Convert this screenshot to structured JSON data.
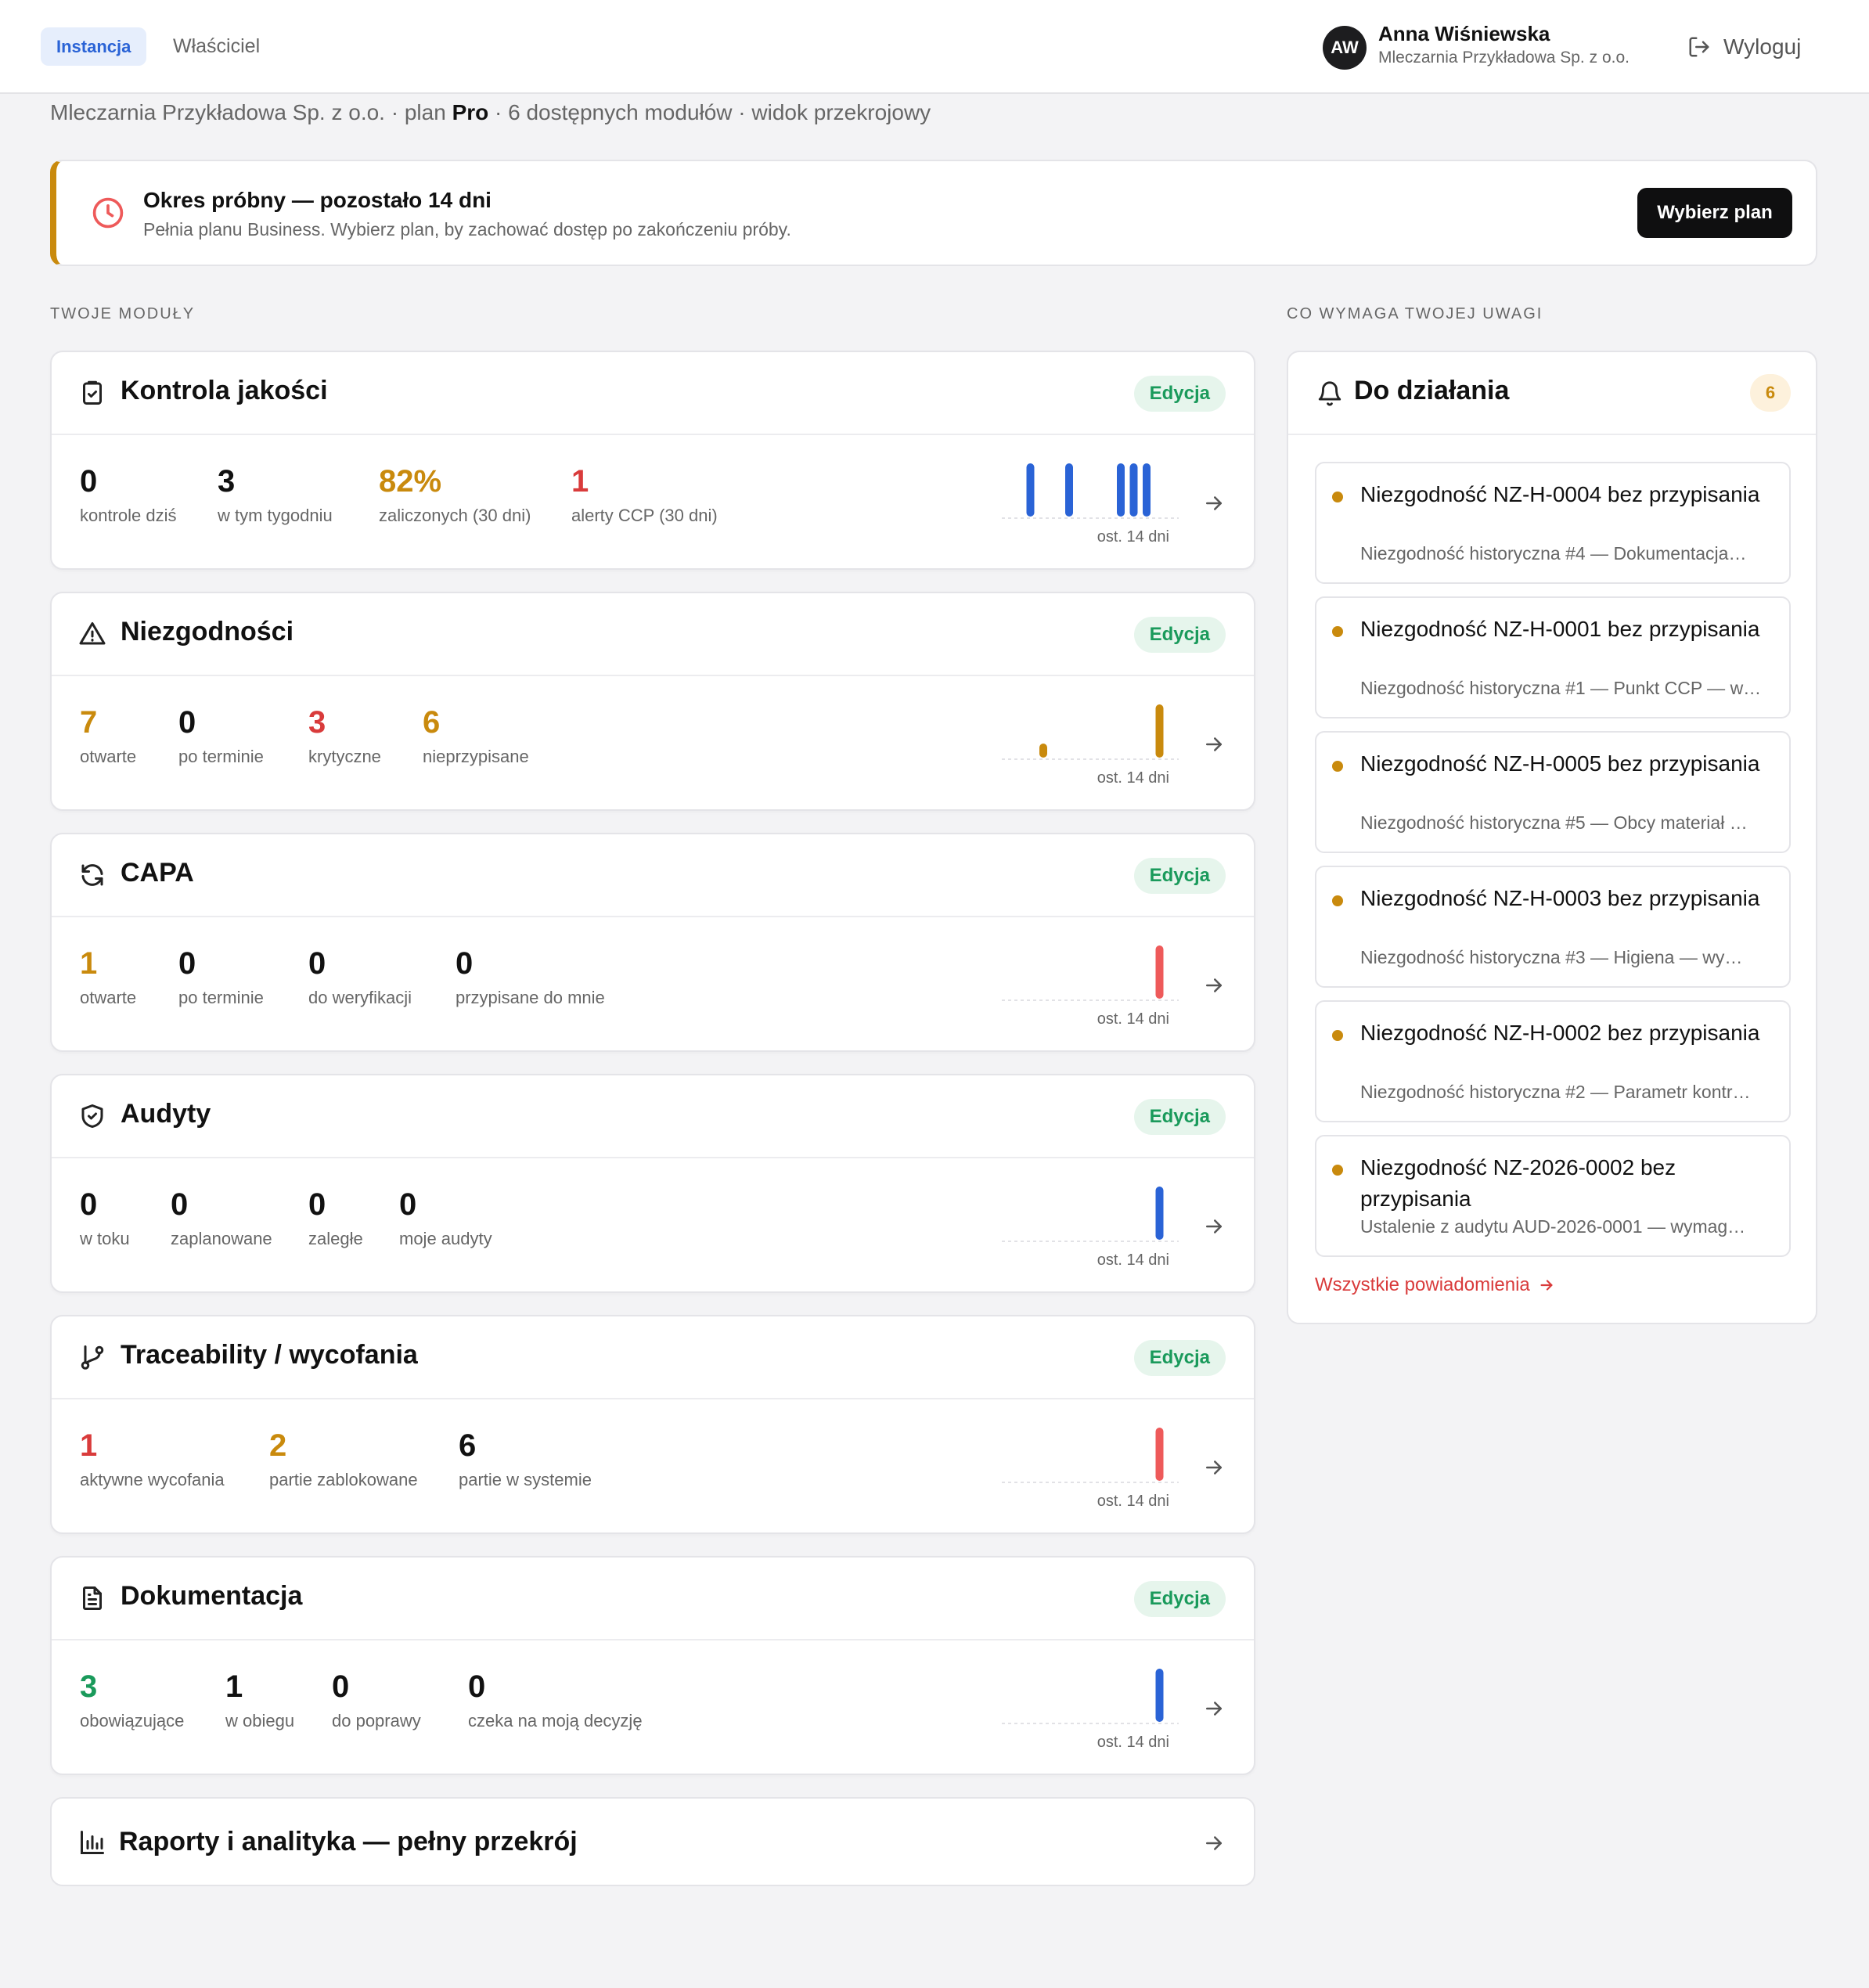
{
  "header": {
    "tabs": [
      {
        "label": "Instancja",
        "active": true
      },
      {
        "label": "Właściciel",
        "active": false
      }
    ],
    "user": {
      "initials": "AW",
      "name": "Anna Wiśniewska",
      "org": "Mleczarnia Przykładowa Sp. z o.o."
    },
    "logout_label": "Wyloguj"
  },
  "subline": {
    "prefix": "Mleczarnia Przykładowa Sp. z o.o. · plan ",
    "plan": "Pro",
    "suffix": " · 6 dostępnych modułów · widok przekrojowy"
  },
  "trial": {
    "title": "Okres próbny — pozostało 14 dni",
    "subtitle": "Pełnia planu Business. Wybierz plan, by zachować dostęp po zakończeniu próby.",
    "button_label": "Wybierz plan"
  },
  "sections": {
    "modules_label": "TWOJE MODUŁY",
    "attention_label": "CO WYMAGA TWOJEJ UWAGI"
  },
  "colors": {
    "amber": "#c98a0d",
    "red": "#d93b3b",
    "green": "#1a9a5b",
    "blue": "#2a63d6",
    "spark_red": "#ee5a5a"
  },
  "modules": [
    {
      "title": "Kontrola jakości",
      "icon": "clipboard-check-icon",
      "badge": "Edycja",
      "stats": [
        {
          "value": "0",
          "label": "kontrole dziś",
          "tone": "dark"
        },
        {
          "value": "3",
          "label": "w tym tygodniu",
          "tone": "dark"
        },
        {
          "value": "82%",
          "label": "zaliczonych (30 dni)",
          "tone": "amber"
        },
        {
          "value": "1",
          "label": "alerty CCP (30 dni)",
          "tone": "red"
        }
      ],
      "spark": {
        "color": "#2a63d6",
        "label": "ost. 14 dni",
        "values": [
          0,
          1,
          0,
          0,
          1,
          0,
          0,
          0,
          1,
          1,
          1,
          0,
          0,
          0
        ]
      }
    },
    {
      "title": "Niezgodności",
      "icon": "warning-triangle-icon",
      "badge": "Edycja",
      "stats": [
        {
          "value": "7",
          "label": "otwarte",
          "tone": "amber"
        },
        {
          "value": "0",
          "label": "po terminie",
          "tone": "dark"
        },
        {
          "value": "3",
          "label": "krytyczne",
          "tone": "red"
        },
        {
          "value": "6",
          "label": "nieprzypisane",
          "tone": "amber"
        }
      ],
      "spark": {
        "color": "#c98a0d",
        "label": "ost. 14 dni",
        "values": [
          0,
          0,
          1,
          0,
          0,
          0,
          0,
          0,
          0,
          0,
          0,
          6,
          0,
          0
        ]
      }
    },
    {
      "title": "CAPA",
      "icon": "refresh-icon",
      "badge": "Edycja",
      "stats": [
        {
          "value": "1",
          "label": "otwarte",
          "tone": "amber"
        },
        {
          "value": "0",
          "label": "po terminie",
          "tone": "dark"
        },
        {
          "value": "0",
          "label": "do weryfikacji",
          "tone": "dark"
        },
        {
          "value": "0",
          "label": "przypisane do mnie",
          "tone": "dark"
        }
      ],
      "spark": {
        "color": "#ee5a5a",
        "label": "ost. 14 dni",
        "values": [
          0,
          0,
          0,
          0,
          0,
          0,
          0,
          0,
          0,
          0,
          0,
          1,
          0,
          0
        ]
      }
    },
    {
      "title": "Audyty",
      "icon": "shield-check-icon",
      "badge": "Edycja",
      "stats": [
        {
          "value": "0",
          "label": "w toku",
          "tone": "dark"
        },
        {
          "value": "0",
          "label": "zaplanowane",
          "tone": "dark"
        },
        {
          "value": "0",
          "label": "zaległe",
          "tone": "dark"
        },
        {
          "value": "0",
          "label": "moje audyty",
          "tone": "dark"
        }
      ],
      "spark": {
        "color": "#2a63d6",
        "label": "ost. 14 dni",
        "values": [
          0,
          0,
          0,
          0,
          0,
          0,
          0,
          0,
          0,
          0,
          0,
          1,
          0,
          0
        ]
      }
    },
    {
      "title": "Traceability / wycofania",
      "icon": "git-branch-icon",
      "badge": "Edycja",
      "stats": [
        {
          "value": "1",
          "label": "aktywne wycofania",
          "tone": "red"
        },
        {
          "value": "2",
          "label": "partie zablokowane",
          "tone": "amber"
        },
        {
          "value": "6",
          "label": "partie w systemie",
          "tone": "dark"
        }
      ],
      "spark": {
        "color": "#ee5a5a",
        "label": "ost. 14 dni",
        "values": [
          0,
          0,
          0,
          0,
          0,
          0,
          0,
          0,
          0,
          0,
          0,
          1,
          0,
          0
        ]
      }
    },
    {
      "title": "Dokumentacja",
      "icon": "document-icon",
      "badge": "Edycja",
      "stats": [
        {
          "value": "3",
          "label": "obowiązujące",
          "tone": "green"
        },
        {
          "value": "1",
          "label": "w obiegu",
          "tone": "dark"
        },
        {
          "value": "0",
          "label": "do poprawy",
          "tone": "dark"
        },
        {
          "value": "0",
          "label": "czeka na moją decyzję",
          "tone": "dark"
        }
      ],
      "spark": {
        "color": "#2a63d6",
        "label": "ost. 14 dni",
        "values": [
          0,
          0,
          0,
          0,
          0,
          0,
          0,
          0,
          0,
          0,
          0,
          1,
          0,
          0
        ]
      }
    }
  ],
  "reports": {
    "title": "Raporty i analityka — pełny przekrój",
    "icon": "bar-chart-icon"
  },
  "panel": {
    "title": "Do działania",
    "count": "6",
    "items": [
      {
        "title": "Niezgodność NZ-H-0004 bez przypisania",
        "subtitle": "Niezgodność historyczna #4 — Dokumentacja…"
      },
      {
        "title": "Niezgodność NZ-H-0001 bez przypisania",
        "subtitle": "Niezgodność historyczna #1 — Punkt CCP — w…"
      },
      {
        "title": "Niezgodność NZ-H-0005 bez przypisania",
        "subtitle": "Niezgodność historyczna #5 — Obcy materiał …"
      },
      {
        "title": "Niezgodność NZ-H-0003 bez przypisania",
        "subtitle": "Niezgodność historyczna #3 — Higiena — wy…"
      },
      {
        "title": "Niezgodność NZ-H-0002 bez przypisania",
        "subtitle": "Niezgodność historyczna #2 — Parametr kontr…"
      },
      {
        "title": "Niezgodność NZ-2026-0002 bez przypisania",
        "subtitle": "Ustalenie z audytu AUD-2026-0001 — wymag…"
      }
    ],
    "link_label": "Wszystkie powiadomienia"
  }
}
